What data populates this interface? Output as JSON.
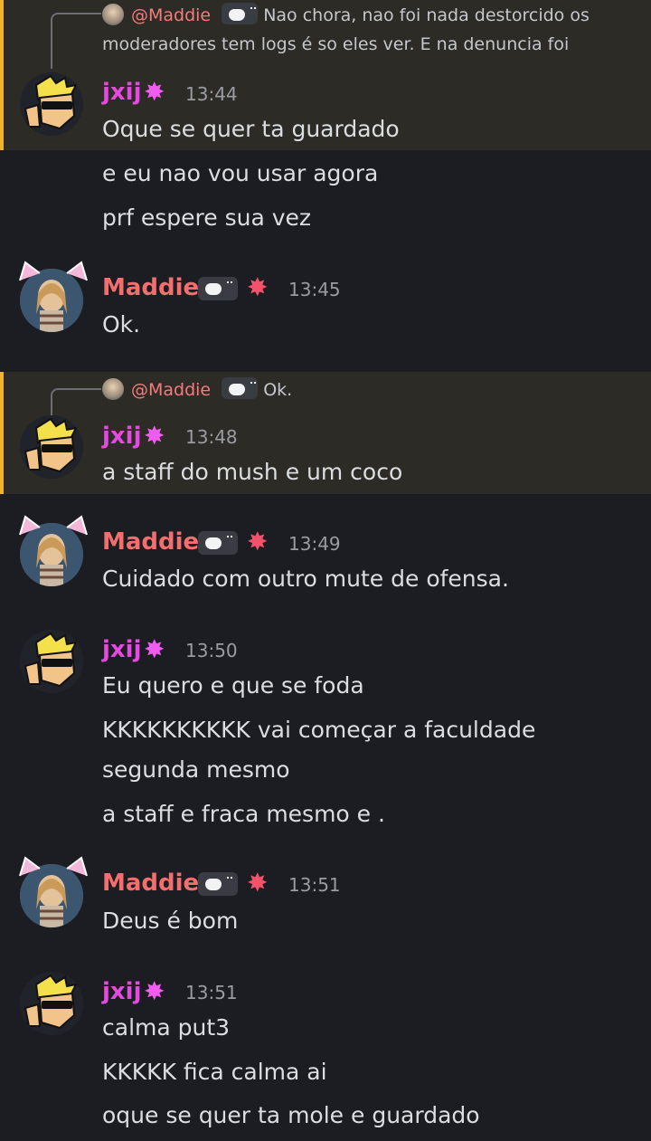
{
  "messages": {
    "m1": {
      "reply_name": "@Maddie",
      "reply_text_1": "Nao chora, nao foi nada destorcido os",
      "reply_text_2": "moderadores tem logs é so eles ver. E na denuncia foi",
      "author": "jxij",
      "time": "13:44",
      "lines": [
        "Oque se quer ta guardado",
        "e eu nao vou usar agora",
        "prf espere sua vez"
      ]
    },
    "m2": {
      "author": "Maddie",
      "time": "13:45",
      "lines": [
        "Ok."
      ]
    },
    "m3": {
      "reply_name": "@Maddie",
      "reply_text": "Ok.",
      "author": "jxij",
      "time": "13:48",
      "lines": [
        "a staff do mush e um coco"
      ]
    },
    "m4": {
      "author": "Maddie",
      "time": "13:49",
      "lines": [
        "Cuidado com outro mute de ofensa."
      ]
    },
    "m5": {
      "author": "jxij",
      "time": "13:50",
      "lines": [
        "Eu quero e que se foda",
        "KKKKKKKKKK vai começar a faculdade",
        "segunda mesmo",
        "a staff e fraca mesmo e ."
      ]
    },
    "m6": {
      "author": "Maddie",
      "time": "13:51",
      "lines": [
        "Deus é bom"
      ]
    },
    "m7": {
      "author": "jxij",
      "time": "13:51",
      "lines": [
        "calma put3",
        "KKKKK fica calma ai",
        "oque se quer ta mole e guardado"
      ]
    }
  },
  "colors": {
    "jxij": "#e449e0",
    "maddie": "#f46e6e",
    "highlight": "#f0b232"
  }
}
